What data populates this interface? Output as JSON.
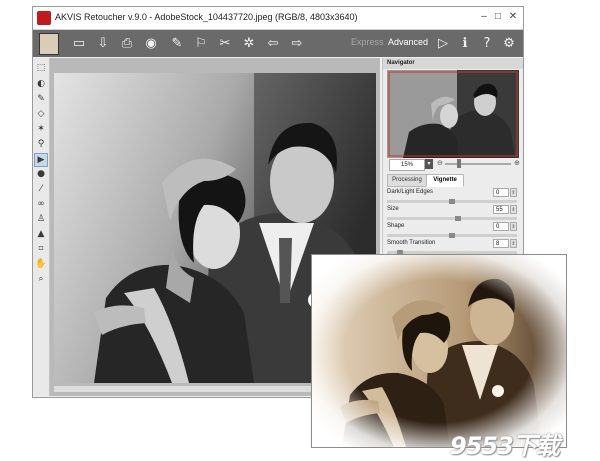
{
  "window": {
    "title": "AKVIS Retoucher v.9.0 - AdobeStock_104437720.jpeg (RGB/8, 4803x3640)",
    "controls": {
      "minimize": "–",
      "maximize": "□",
      "close": "✕"
    }
  },
  "toolbar": {
    "icons": [
      "canvas-icon",
      "open-icon",
      "save-icon",
      "print-icon",
      "share-icon",
      "run-icon",
      "compare-icon",
      "presets-icon",
      "settings-icon",
      "undo-icon",
      "redo-icon"
    ],
    "mode_express": "Express",
    "mode_advanced": "Advanced",
    "right_icons": [
      "play-icon",
      "info-icon",
      "help-icon",
      "gear-icon"
    ]
  },
  "tools": [
    "crop-select-tool",
    "restore-tool",
    "brush-tool",
    "eraser-tool",
    "magic-wand-tool",
    "stamp-tool",
    "run-tool",
    "smudge-tool",
    "eyedropper-tool",
    "chain-tool",
    "clone-tool",
    "bucket-tool",
    "crop-tool",
    "hand-tool",
    "zoom-tool"
  ],
  "navigator": {
    "header": "Navigator",
    "zoom": "15%",
    "minus": "⊖",
    "plus": "⊕",
    "zoom_level": 0.2
  },
  "tabs": {
    "processing": "Processing",
    "vignette": "Vignette"
  },
  "vignette_params": [
    {
      "label": "Dark/Light Edges",
      "value": "0",
      "level": 0.5
    },
    {
      "label": "Size",
      "value": "55",
      "level": 0.55
    },
    {
      "label": "Shape",
      "value": "0",
      "level": 0.5
    },
    {
      "label": "Smooth Transition",
      "value": "8",
      "level": 0.08
    }
  ],
  "watermark": "9553下载",
  "colors": {
    "toolbar": "#6a6a6a",
    "accent": "#c21a1a",
    "sepia": "#8a6a48"
  }
}
